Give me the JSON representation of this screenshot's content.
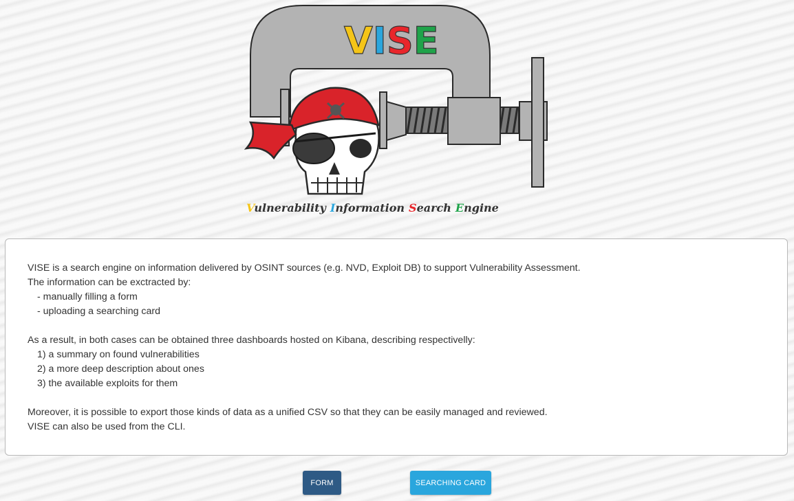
{
  "logo": {
    "title_letters": [
      {
        "char": "V",
        "color": "#f5c518"
      },
      {
        "char": "I",
        "color": "#2aa6dd"
      },
      {
        "char": "S",
        "color": "#e8262b"
      },
      {
        "char": "E",
        "color": "#1fa34a"
      }
    ],
    "tagline_words": [
      {
        "initial": "V",
        "initial_color": "#f5c518",
        "rest": "ulnerability"
      },
      {
        "initial": "I",
        "initial_color": "#2aa6dd",
        "rest": "nformation"
      },
      {
        "initial": "S",
        "initial_color": "#e8262b",
        "rest": "earch"
      },
      {
        "initial": "E",
        "initial_color": "#1fa34a",
        "rest": "ngine"
      }
    ]
  },
  "description": {
    "intro": "VISE is a search engine on information delivered by OSINT sources (e.g. NVD, Exploit DB) to support Vulnerability Assessment.",
    "extract_intro": "The information can be exctracted by:",
    "extract_options": [
      "- manually filling a form",
      "- uploading a searching card"
    ],
    "result_intro": "As a result, in both cases can be obtained three dashboards hosted on Kibana, describing respectivelly:",
    "dashboards": [
      "1) a summary on found vulnerabilities",
      "2) a more deep description about ones",
      "3) the available exploits for them"
    ],
    "export_note": "Moreover, it is possible to export those kinds of data as a unified CSV so that they can be easily managed and reviewed.",
    "cli_note": "VISE can also be used from the CLI."
  },
  "buttons": {
    "form_label": "FORM",
    "card_label": "SEARCHING CARD"
  },
  "colors": {
    "form_button": "#2e5a85",
    "card_button": "#2aa6dd",
    "clamp_gray": "#b3b3b3",
    "bandana_red": "#d9232a"
  }
}
